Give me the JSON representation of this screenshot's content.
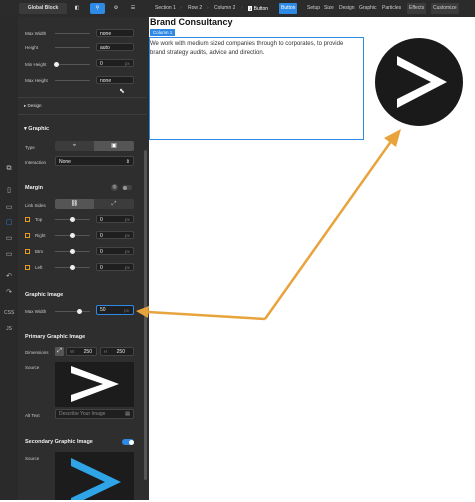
{
  "topbar": {
    "global_block": "Global Block",
    "crumbs": [
      "Section 1",
      "Row 2",
      "Column 2",
      "Button"
    ],
    "tabs": [
      "Button",
      "Setup",
      "Size",
      "Design",
      "Graphic",
      "Particles",
      "Effects",
      "Customize"
    ],
    "crumb_number": "1"
  },
  "size_rows": [
    {
      "label": "Max Width",
      "value": "none"
    },
    {
      "label": "Height",
      "value": "auto"
    },
    {
      "label": "Min Height",
      "value": "0",
      "unit": "px"
    },
    {
      "label": "Max Height",
      "value": "none"
    }
  ],
  "design_label": "Design",
  "graphic": {
    "heading": "Graphic",
    "type_label": "Type",
    "interaction_label": "Interaction",
    "interaction_value": "None"
  },
  "margin": {
    "heading": "Margin",
    "link_sides_label": "Link Sides",
    "rows": [
      {
        "label": "Top",
        "value": "0",
        "unit": "px"
      },
      {
        "label": "Right",
        "value": "0",
        "unit": "px"
      },
      {
        "label": "Btm",
        "value": "0",
        "unit": "px"
      },
      {
        "label": "Left",
        "value": "0",
        "unit": "px"
      }
    ]
  },
  "graphic_image": {
    "heading": "Graphic Image",
    "max_width_label": "Max Width",
    "max_width_value": "50",
    "max_width_unit": "px",
    "slider_fraction": 0.7
  },
  "primary": {
    "heading": "Primary Graphic Image",
    "dimensions_label": "Dimensions",
    "w_label": "W",
    "w_value": "250",
    "h_label": "H",
    "h_value": "250",
    "source_label": "Source",
    "alt_label": "Alt Text",
    "alt_placeholder": "Describe Your Image"
  },
  "secondary": {
    "heading": "Secondary Graphic Image",
    "source_label": "Source"
  },
  "left_icons": [
    "CSS",
    "JS"
  ],
  "content": {
    "title": "Brand Consultancy",
    "column_badge": "Column 1",
    "paragraph": "We work with medium sized companies through to corporates, to provide brand strategy audits, advice and direction."
  },
  "colors": {
    "accent": "#2f8ae5",
    "arrow": "#e8a33c",
    "panel": "#2e2e2e"
  }
}
